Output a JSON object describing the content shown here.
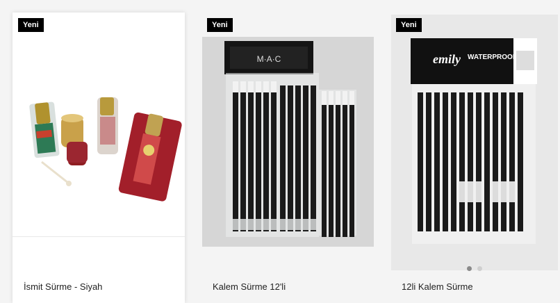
{
  "products": [
    {
      "badge": "Yeni",
      "title": "İsmit Sürme - Siyah",
      "image_icon": "surme-bottles-image"
    },
    {
      "badge": "Yeni",
      "title": "Kalem Sürme 12'li",
      "image_icon": "mac-pencils-image",
      "pack_brand": "M·A·C"
    },
    {
      "badge": "Yeni",
      "title": "12li Kalem Sürme",
      "image_icon": "emily-pencils-image",
      "pack_brand": "emily",
      "pack_label": "WATERPROOF",
      "carousel": {
        "count": 2,
        "active": 1
      }
    }
  ],
  "colors": {
    "badge_bg": "#000000",
    "badge_text": "#ffffff",
    "title_text": "#222222"
  }
}
